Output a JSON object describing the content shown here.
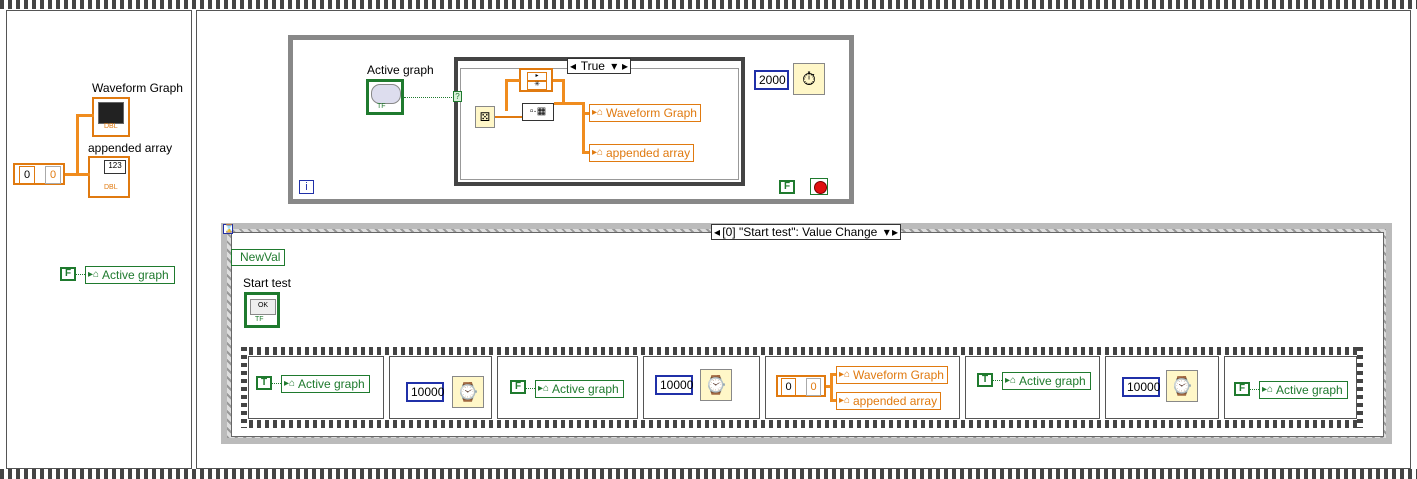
{
  "left_panel": {
    "waveform_label": "Waveform Graph",
    "appended_label": "appended array",
    "const_zero": "0",
    "init_zero": "0",
    "local_false": "F",
    "local_active": "Active graph"
  },
  "while_loop": {
    "active_label": "Active graph",
    "case_selector": "True",
    "waveform_local": "Waveform Graph",
    "appended_local": "appended array",
    "wait_ms": "2000",
    "iteration": "i",
    "stop_const": "F"
  },
  "event_structure": {
    "selector": "[0] \"Start test\": Value Change",
    "newval": "NewVal",
    "start_label": "Start test",
    "ok_text": "OK",
    "frames": [
      {
        "bool": "T",
        "local": "Active graph"
      },
      {
        "wait": "10000"
      },
      {
        "bool": "F",
        "local": "Active graph"
      },
      {
        "wait": "10000"
      },
      {
        "zero": "0",
        "zero2": "0",
        "local1": "Waveform Graph",
        "local2": "appended array"
      },
      {
        "bool": "T",
        "local": "Active graph"
      },
      {
        "wait": "10000"
      },
      {
        "bool": "F",
        "local": "Active graph"
      }
    ]
  },
  "colors": {
    "orange": "#e07a10",
    "green": "#1f7a2e",
    "blue": "#2030a8"
  }
}
